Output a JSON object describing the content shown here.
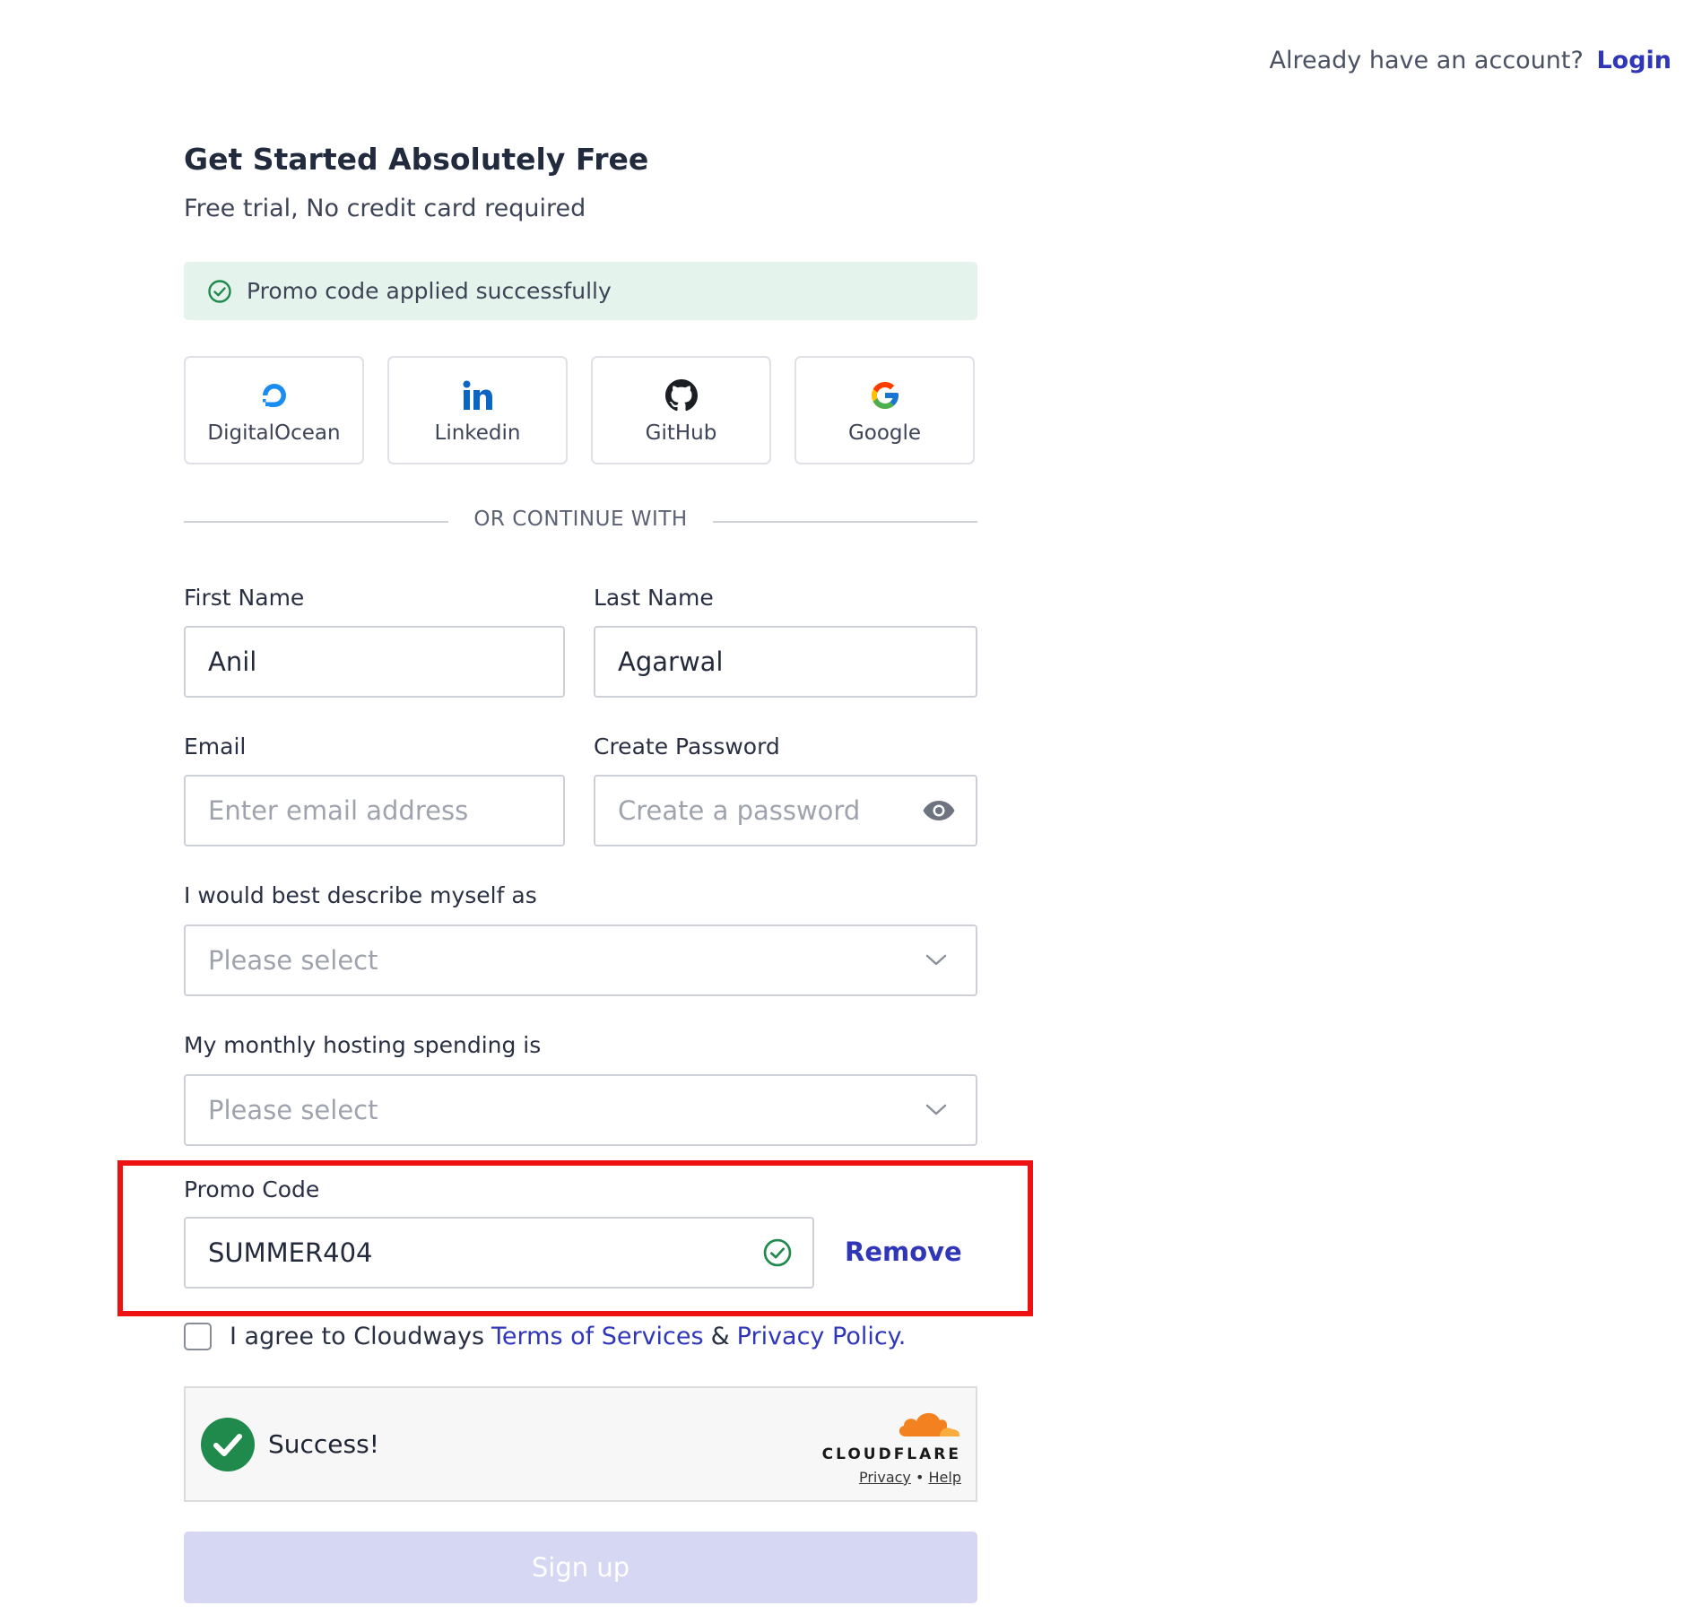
{
  "header": {
    "prompt": "Already have an account?",
    "login_label": "Login"
  },
  "hero": {
    "title": "Get Started Absolutely Free",
    "subtitle": "Free trial, No credit card required"
  },
  "alert": {
    "message": "Promo code applied successfully",
    "icon": "check-circle-icon"
  },
  "social": [
    {
      "label": "DigitalOcean",
      "icon": "digitalocean-icon"
    },
    {
      "label": "Linkedin",
      "icon": "linkedin-icon"
    },
    {
      "label": "GitHub",
      "icon": "github-icon"
    },
    {
      "label": "Google",
      "icon": "google-icon"
    }
  ],
  "divider": "OR CONTINUE WITH",
  "form": {
    "first_name": {
      "label": "First Name",
      "value": "Anil"
    },
    "last_name": {
      "label": "Last Name",
      "value": "Agarwal"
    },
    "email": {
      "label": "Email",
      "placeholder": "Enter email address"
    },
    "password": {
      "label": "Create Password",
      "placeholder": "Create a password"
    },
    "describe": {
      "label": "I would best describe myself as",
      "placeholder": "Please select"
    },
    "spending": {
      "label": "My monthly hosting spending is",
      "placeholder": "Please select"
    },
    "promo": {
      "label": "Promo Code",
      "value": "SUMMER404",
      "remove_label": "Remove"
    }
  },
  "agreement": {
    "prefix": "I agree to Cloudways",
    "terms": "Terms of Services",
    "amp": "&",
    "privacy": "Privacy Policy."
  },
  "captcha": {
    "status": "Success!",
    "brand": "CLOUDFLARE",
    "privacy": "Privacy",
    "sep": "•",
    "help": "Help"
  },
  "signup_label": "Sign up",
  "colors": {
    "accent": "#2f36b8",
    "success": "#1f8a4c",
    "alert_bg": "#e4f3ec",
    "highlight": "#ee1111",
    "signup_disabled": "#d6d7f3"
  }
}
